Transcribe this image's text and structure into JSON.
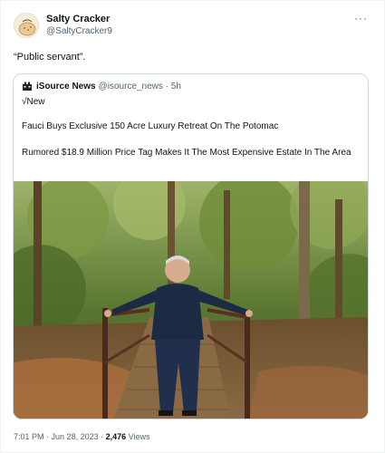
{
  "tweet": {
    "author_name": "Salty Cracker",
    "author_handle": "@SaltyCracker9",
    "more_label": "···",
    "text": "“Public servant”.",
    "time": "7:01 PM",
    "date": "Jun 28, 2023",
    "views_count": "2,476",
    "views_label": "Views"
  },
  "quote": {
    "source_name": "iSource News",
    "source_handle": "@isource_news",
    "age": "5h",
    "new_label": "√New",
    "headline": "Fauci Buys Exclusive 150 Acre Luxury Retreat On The Potomac",
    "subheadline": "Rumored $18.9 Million Price Tag Makes It The Most Expensive Estate In The Area"
  },
  "icons": {
    "avatar": "salty-cracker-avatar",
    "more": "more-options-icon",
    "source_logo": "isource-logo-icon"
  },
  "colors": {
    "text_primary": "#0f1419",
    "text_secondary": "#536471",
    "border": "#cfd9de"
  }
}
